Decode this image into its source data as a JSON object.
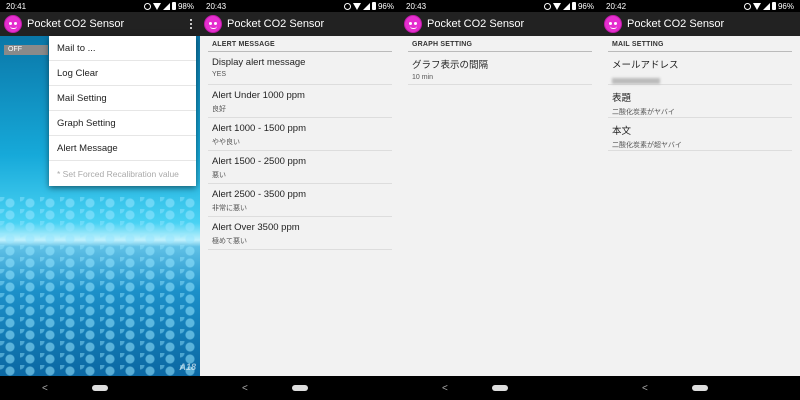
{
  "app": {
    "title": "Pocket CO2 Sensor"
  },
  "screens": [
    {
      "status": {
        "time": "20:41",
        "battery": "98%"
      }
    },
    {
      "status": {
        "time": "20:43",
        "battery": "96%"
      }
    },
    {
      "status": {
        "time": "20:43",
        "battery": "96%"
      }
    },
    {
      "status": {
        "time": "20:42",
        "battery": "96%"
      }
    }
  ],
  "main": {
    "toggle_label": "OFF",
    "watermark": "A18",
    "menu": [
      {
        "label": "Mail to ..."
      },
      {
        "label": "Log Clear"
      },
      {
        "label": "Mail Setting"
      },
      {
        "label": "Graph Setting"
      },
      {
        "label": "Alert Message"
      },
      {
        "label": "* Set Forced Recalibration value",
        "disabled": true
      }
    ]
  },
  "alert_message": {
    "header": "ALERT MESSAGE",
    "items": [
      {
        "title": "Display alert message",
        "summary": "YES"
      },
      {
        "title": "Alert Under 1000 ppm",
        "summary": "良好"
      },
      {
        "title": "Alert 1000 - 1500 ppm",
        "summary": "やや良い"
      },
      {
        "title": "Alert 1500 - 2500 ppm",
        "summary": "悪い"
      },
      {
        "title": "Alert 2500 - 3500 ppm",
        "summary": "非常に悪い"
      },
      {
        "title": "Alert Over 3500 ppm",
        "summary": "極めて悪い"
      }
    ]
  },
  "graph_setting": {
    "header": "GRAPH SETTING",
    "items": [
      {
        "title": "グラフ表示の間隔",
        "summary": "10 min"
      }
    ]
  },
  "mail_setting": {
    "header": "MAIL SETTING",
    "items": [
      {
        "title": "メールアドレス"
      },
      {
        "title": "表題",
        "summary": "二酸化炭素がヤバイ"
      },
      {
        "title": "本文",
        "summary": "二酸化炭素が超ヤバイ"
      }
    ]
  },
  "nav": {
    "back_glyph": "<"
  }
}
